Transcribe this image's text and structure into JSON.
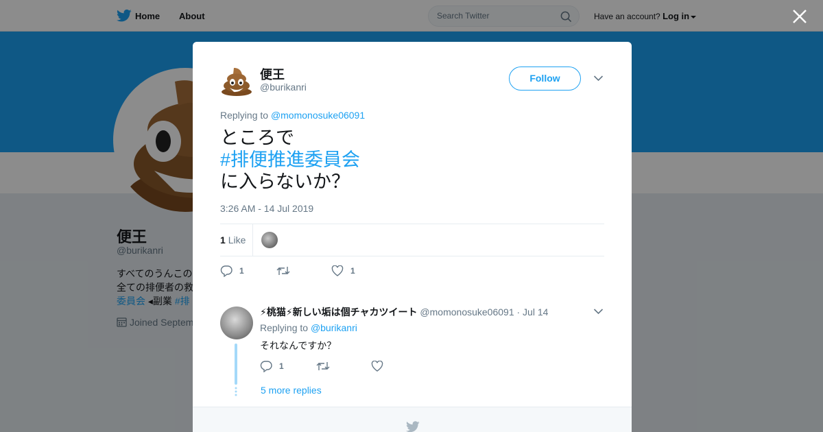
{
  "nav": {
    "home_label": "Home",
    "about_label": "About",
    "search_placeholder": "Search Twitter",
    "account_prompt": "Have an account?",
    "login_label": "Log in"
  },
  "profile": {
    "name": "便王",
    "handle": "@burikanri",
    "bio_line1": "すべてのうんこの",
    "bio_line2": "全ての排便者の救",
    "bio_line3_link": "委員会",
    "bio_line3_text": " ◂副業 ",
    "bio_line3_link2": "#排",
    "joined": "Joined Septem"
  },
  "tweet": {
    "author_name": "便王",
    "author_handle": "@burikanri",
    "follow_label": "Follow",
    "replying_prefix": "Replying to",
    "replying_to": "@momonosuke06091",
    "text_line1": "ところで",
    "hashtag": "#排便推進委員会",
    "text_line3": "に入らないか？",
    "timestamp": "3:26 AM - 14 Jul 2019",
    "like_count": "1",
    "like_label": "Like",
    "reply_count": "1",
    "retweet_count": "",
    "favorite_count": "1"
  },
  "reply": {
    "author_name": "⚡桃猫⚡新しい垢は個チャカツイート",
    "author_handle": "@momonosuke06091",
    "date": "· Jul 14",
    "replying_prefix": "Replying to",
    "replying_to": "@burikanri",
    "text": "それなんですか？",
    "reply_count": "1",
    "retweet_count": "",
    "favorite_count": ""
  },
  "more_replies_label": "5 more replies",
  "colors": {
    "accent": "#1da1f2",
    "muted": "#657786",
    "text": "#14171a",
    "banner": "#1da1f2"
  },
  "icons": [
    "twitter-bird-icon",
    "search-icon",
    "close-icon",
    "chevron-down-icon",
    "reply-icon",
    "retweet-icon",
    "heart-icon",
    "calendar-icon",
    "poop-emoji-icon"
  ]
}
